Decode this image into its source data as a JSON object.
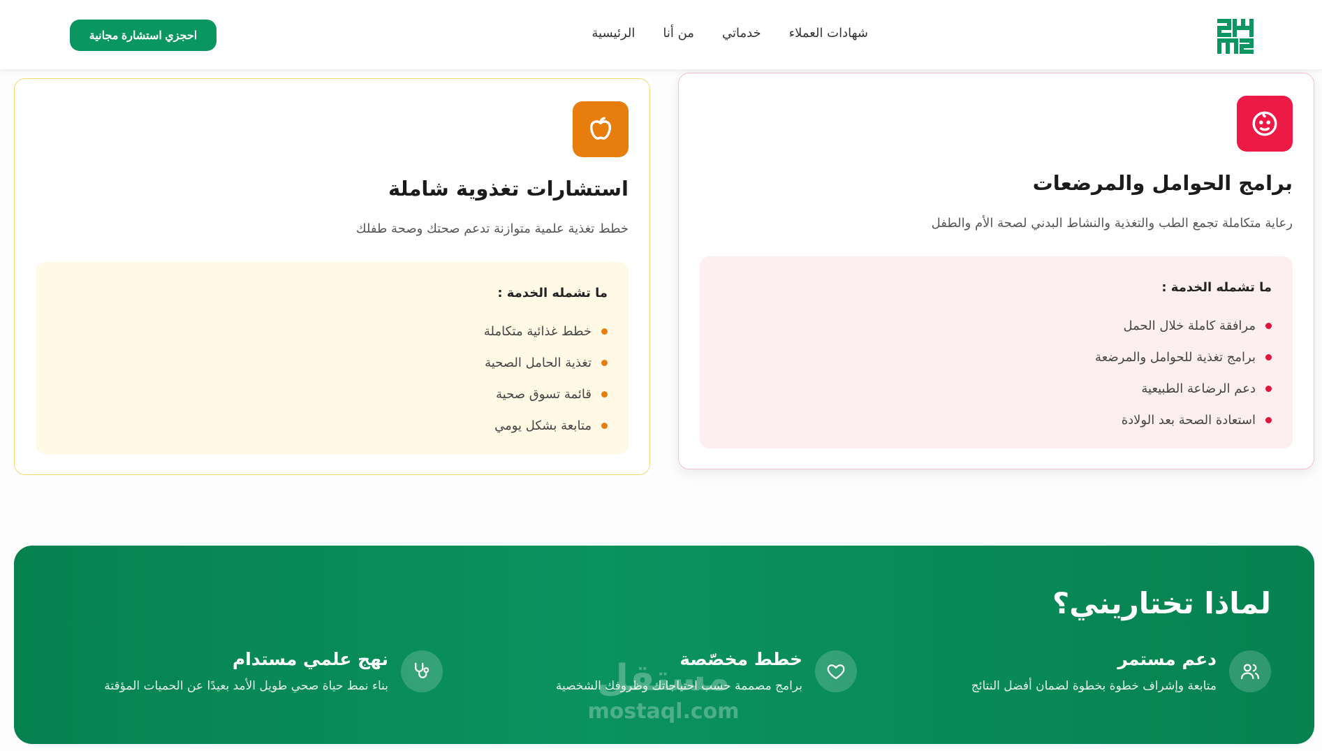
{
  "header": {
    "logo_icon": "brand-logo-icon",
    "nav": [
      "الرئيسية",
      "من أنا",
      "خدماتي",
      "شهادات العملاء"
    ],
    "cta_label": "احجزي استشارة مجانية"
  },
  "cards": {
    "nutrition": {
      "icon": "apple-icon",
      "accent": "#e67d0c",
      "title": "استشارات تغذوية شاملة",
      "desc": "خطط تغذية علمية متوازنة تدعم صحتك وصحة طفلك",
      "includes_title": "ما تشمله الخدمة :",
      "items": [
        "خطط غذائية متكاملة",
        "تغذية الحامل الصحية",
        "قائمة تسوق صحية",
        "متابعة بشكل يومي"
      ]
    },
    "pregnancy": {
      "icon": "baby-face-icon",
      "accent": "#ec1a45",
      "title": "برامج الحوامل والمرضعات",
      "desc": "رعاية متكاملة تجمع الطب والتغذية والنشاط البدني لصحة الأم والطفل",
      "includes_title": "ما تشمله الخدمة :",
      "items": [
        "مرافقة كاملة خلال الحمل",
        "برامج تغذية للحوامل والمرضعة",
        "دعم الرضاعة الطبيعية",
        "استعادة الصحة بعد الولادة"
      ]
    }
  },
  "why": {
    "title": "لماذا تختاريني؟",
    "features": [
      {
        "icon": "users-icon",
        "title": "دعم مستمر",
        "desc": "متابعة وإشراف خطوة بخطوة لضمان أفضل النتائج"
      },
      {
        "icon": "heart-icon",
        "title": "خطط مخصّصة",
        "desc": "برامج مصممة حسب احتياجاتك وظروفك الشخصية"
      },
      {
        "icon": "stethoscope-icon",
        "title": "نهج علمي مستدام",
        "desc": "بناء نمط حياة صحي طويل الأمد بعيدًا عن الحميات المؤقتة"
      }
    ],
    "background": "#0a925f"
  },
  "watermark": {
    "arabic": "مستقل",
    "latin": "mostaql.com"
  }
}
